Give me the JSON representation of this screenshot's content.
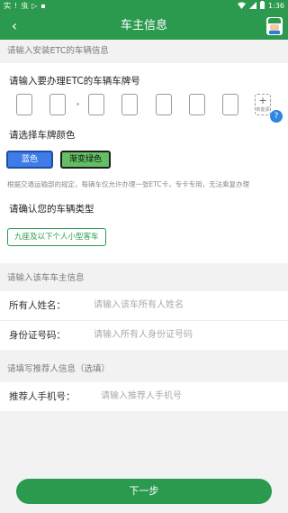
{
  "status_bar": {
    "left_icons": [
      "carrier-icon",
      "warning-icon",
      "carrier-icon",
      "message-icon",
      "sim-icon"
    ],
    "left_texts": [
      "实",
      "!",
      "虫",
      "▷",
      "▪"
    ],
    "time": "1:36"
  },
  "appbar": {
    "back_glyph": "‹",
    "title": "车主信息"
  },
  "vehicle_section": {
    "header": "请输入安装ETC的车辆信息",
    "plate_label": "请输入要办理ETC的车辆车牌号",
    "plate_add_plus": "+",
    "plate_add_text": "新能源",
    "info_badge": "?",
    "color_label": "请选择车牌颜色",
    "colors": [
      "蓝色",
      "渐变绿色"
    ],
    "note": "根据交通运输部的规定，每辆车仅允许办理一张ETC卡，专卡专用，无法乘复办理",
    "type_label": "请确认您的车辆类型",
    "vehicle_type": "九座及以下个人小型客车"
  },
  "owner_section": {
    "header": "请输入该车车主信息",
    "name_label": "所有人姓名：",
    "name_placeholder": "请输入该车所有人姓名",
    "id_label": "身份证号码：",
    "id_placeholder": "请输入所有人身份证号码"
  },
  "referrer_section": {
    "header": "请填写推荐人信息（选填）",
    "phone_label": "推荐人手机号：",
    "phone_placeholder": "请输入推荐人手机号"
  },
  "footer": {
    "next_label": "下一步"
  },
  "colors": {
    "brand_green": "#2b9a4e",
    "plate_blue": "#3f7ce8",
    "plate_green": "#62bf63"
  }
}
